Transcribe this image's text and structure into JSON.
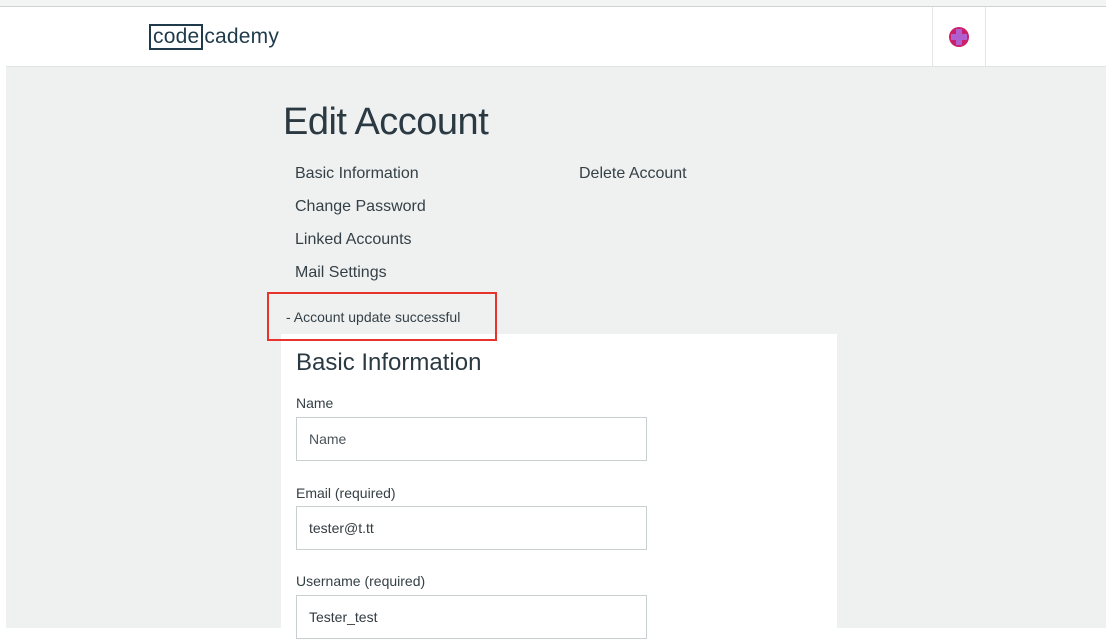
{
  "header": {
    "logo_left": "code",
    "logo_right": "cademy",
    "avatar_colors": {
      "base": "#cc1f6a",
      "accent": "#b05fd0"
    }
  },
  "page": {
    "title": "Edit Account"
  },
  "nav": {
    "basic_information": "Basic Information",
    "change_password": "Change Password",
    "linked_accounts": "Linked Accounts",
    "mail_settings": "Mail Settings",
    "delete_account": "Delete Account"
  },
  "status": {
    "message": "- Account update successful",
    "highlight_color": "#e8332a"
  },
  "form": {
    "title": "Basic Information",
    "name": {
      "label": "Name",
      "placeholder": "Name",
      "value": ""
    },
    "email": {
      "label": "Email (required)",
      "value": "tester@t.tt"
    },
    "username": {
      "label": "Username (required)",
      "value": "Tester_test"
    }
  }
}
